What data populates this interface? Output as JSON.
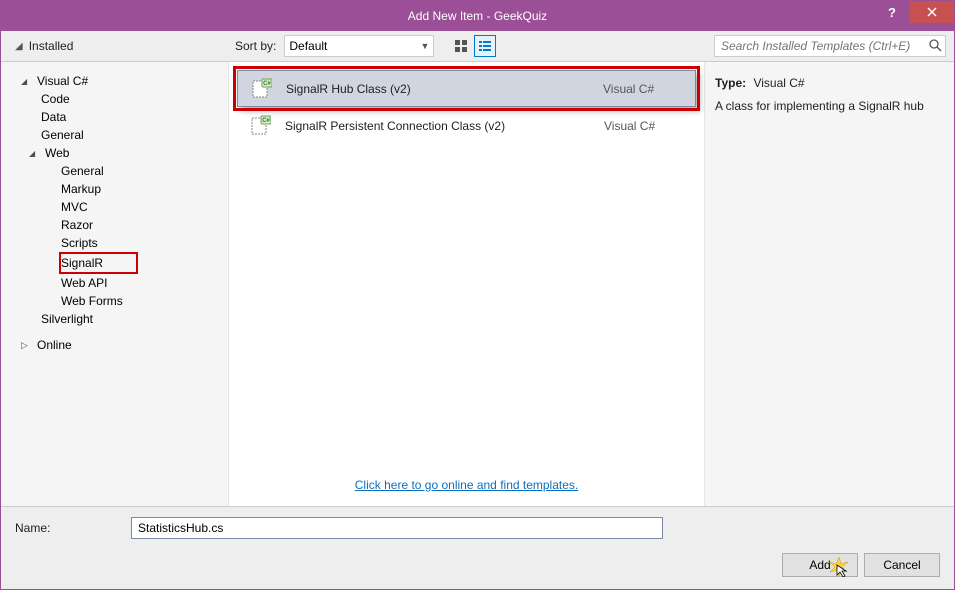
{
  "window": {
    "title": "Add New Item - GeekQuiz"
  },
  "toolbar": {
    "installed_label": "Installed",
    "sortby_label": "Sort by:",
    "sortby_value": "Default",
    "search_placeholder": "Search Installed Templates (Ctrl+E)"
  },
  "tree": {
    "root_label": "Visual C#",
    "items_l2": [
      "Code",
      "Data",
      "General"
    ],
    "web_label": "Web",
    "web_items": [
      "General",
      "Markup",
      "MVC",
      "Razor",
      "Scripts",
      "SignalR",
      "Web API",
      "Web Forms"
    ],
    "silverlight_label": "Silverlight",
    "online_label": "Online"
  },
  "templates": [
    {
      "name": "SignalR Hub Class (v2)",
      "lang": "Visual C#"
    },
    {
      "name": "SignalR Persistent Connection Class (v2)",
      "lang": "Visual C#"
    }
  ],
  "online_link": "Click here to go online and find templates.",
  "details": {
    "type_label": "Type:",
    "type_value": "Visual C#",
    "description": "A class for implementing a SignalR hub"
  },
  "footer": {
    "name_label": "Name:",
    "name_value": "StatisticsHub.cs",
    "add_label": "Add",
    "cancel_label": "Cancel"
  }
}
